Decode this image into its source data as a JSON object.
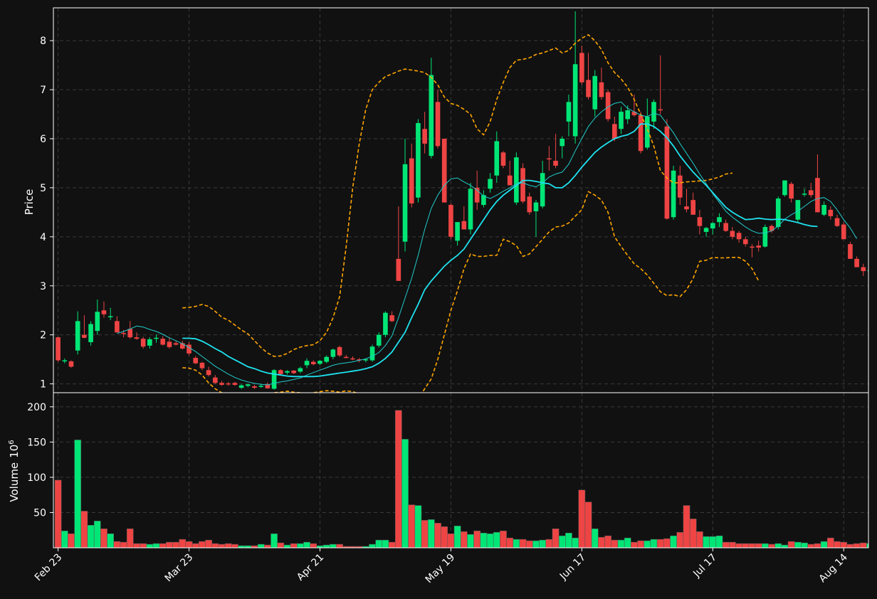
{
  "chart_data": [
    {
      "type": "candlestick",
      "ylabel": "Price",
      "ylim": [
        0.82,
        8.67
      ],
      "yticks": [
        "1",
        "2",
        "3",
        "4",
        "5",
        "6",
        "7",
        "8"
      ],
      "x_tick_labels": [
        "Feb 23",
        "Mar 23",
        "Apr 21",
        "May 19",
        "Jun 17",
        "Jul 17",
        "Aug 14"
      ],
      "x_tick_indices": [
        0,
        20,
        40,
        60,
        80,
        100,
        120
      ],
      "grid": true,
      "colors": {
        "up": "#00e676",
        "down": "#ef4444",
        "ma_fast": "#22cccc",
        "ma_slow": "#1ee3f0",
        "bands": "#ffa500"
      },
      "ohlc": [
        [
          1.95,
          1.96,
          1.45,
          1.48
        ],
        [
          1.46,
          1.52,
          1.42,
          1.48
        ],
        [
          1.46,
          1.48,
          1.33,
          1.35
        ],
        [
          1.68,
          2.48,
          1.6,
          2.28
        ],
        [
          2.0,
          2.4,
          1.93,
          1.94
        ],
        [
          1.85,
          2.28,
          1.78,
          2.22
        ],
        [
          2.08,
          2.72,
          2.0,
          2.47
        ],
        [
          2.5,
          2.68,
          2.35,
          2.42
        ],
        [
          2.38,
          2.55,
          2.3,
          2.38
        ],
        [
          2.28,
          2.38,
          2.05,
          2.05
        ],
        [
          2.04,
          2.1,
          1.95,
          2.02
        ],
        [
          2.12,
          2.28,
          1.92,
          1.95
        ],
        [
          1.95,
          2.05,
          1.9,
          1.92
        ],
        [
          1.92,
          1.96,
          1.72,
          1.76
        ],
        [
          1.78,
          1.95,
          1.72,
          1.91
        ],
        [
          1.93,
          2.01,
          1.84,
          1.94
        ],
        [
          1.92,
          1.97,
          1.78,
          1.8
        ],
        [
          1.86,
          1.95,
          1.72,
          1.75
        ],
        [
          1.83,
          1.87,
          1.78,
          1.8
        ],
        [
          1.83,
          1.88,
          1.7,
          1.72
        ],
        [
          1.8,
          1.85,
          1.58,
          1.62
        ],
        [
          1.53,
          1.57,
          1.4,
          1.42
        ],
        [
          1.43,
          1.45,
          1.28,
          1.32
        ],
        [
          1.28,
          1.35,
          1.15,
          1.18
        ],
        [
          1.13,
          1.18,
          1.0,
          1.02
        ],
        [
          1.02,
          1.06,
          0.96,
          0.98
        ],
        [
          1.01,
          1.04,
          0.96,
          0.99
        ],
        [
          1.02,
          1.04,
          0.96,
          0.98
        ],
        [
          0.92,
          0.99,
          0.9,
          0.97
        ],
        [
          0.96,
          1.0,
          0.93,
          0.99
        ],
        [
          0.95,
          0.98,
          0.9,
          0.92
        ],
        [
          0.95,
          1.0,
          0.92,
          0.96
        ],
        [
          0.99,
          1.03,
          0.9,
          0.91
        ],
        [
          0.9,
          1.3,
          0.88,
          1.28
        ],
        [
          1.28,
          1.3,
          1.18,
          1.2
        ],
        [
          1.23,
          1.28,
          1.19,
          1.26
        ],
        [
          1.27,
          1.28,
          1.2,
          1.22
        ],
        [
          1.25,
          1.35,
          1.22,
          1.32
        ],
        [
          1.38,
          1.52,
          1.32,
          1.47
        ],
        [
          1.45,
          1.48,
          1.38,
          1.4
        ],
        [
          1.41,
          1.49,
          1.38,
          1.47
        ],
        [
          1.45,
          1.58,
          1.42,
          1.55
        ],
        [
          1.55,
          1.72,
          1.5,
          1.7
        ],
        [
          1.75,
          1.78,
          1.55,
          1.58
        ],
        [
          1.55,
          1.59,
          1.52,
          1.54
        ],
        [
          1.52,
          1.56,
          1.48,
          1.5
        ],
        [
          1.5,
          1.53,
          1.44,
          1.48
        ],
        [
          1.48,
          1.52,
          1.44,
          1.5
        ],
        [
          1.48,
          1.8,
          1.45,
          1.76
        ],
        [
          1.78,
          2.05,
          1.74,
          2.0
        ],
        [
          2.0,
          2.48,
          1.95,
          2.45
        ],
        [
          2.4,
          2.48,
          2.26,
          2.28
        ],
        [
          3.55,
          4.62,
          3.45,
          3.1
        ],
        [
          3.9,
          6.0,
          3.7,
          5.48
        ],
        [
          5.6,
          5.9,
          4.6,
          4.68
        ],
        [
          4.8,
          6.4,
          4.7,
          6.32
        ],
        [
          6.2,
          6.55,
          5.7,
          5.9
        ],
        [
          5.65,
          7.65,
          5.6,
          7.3
        ],
        [
          6.75,
          7.0,
          5.8,
          5.85
        ],
        [
          6.0,
          6.0,
          4.8,
          4.7
        ],
        [
          4.65,
          4.68,
          3.95,
          4.0
        ],
        [
          3.92,
          4.3,
          3.82,
          4.3
        ],
        [
          4.32,
          4.62,
          4.15,
          4.15
        ],
        [
          4.15,
          5.1,
          4.05,
          4.98
        ],
        [
          5.0,
          5.35,
          4.55,
          4.7
        ],
        [
          4.65,
          4.95,
          4.6,
          4.85
        ],
        [
          4.98,
          5.3,
          4.9,
          5.18
        ],
        [
          5.25,
          6.15,
          5.1,
          5.95
        ],
        [
          5.72,
          5.75,
          5.4,
          5.45
        ],
        [
          5.25,
          5.55,
          5.05,
          5.05
        ],
        [
          4.7,
          5.72,
          4.65,
          5.62
        ],
        [
          5.4,
          5.5,
          4.68,
          4.72
        ],
        [
          4.82,
          4.9,
          4.45,
          4.5
        ],
        [
          4.52,
          4.75,
          4.0,
          4.7
        ],
        [
          4.62,
          5.55,
          4.58,
          5.3
        ],
        [
          5.6,
          5.85,
          5.35,
          5.58
        ],
        [
          5.55,
          6.1,
          5.4,
          5.45
        ],
        [
          5.85,
          6.05,
          5.6,
          6.0
        ],
        [
          6.35,
          6.9,
          6.05,
          6.75
        ],
        [
          6.05,
          8.6,
          5.9,
          7.52
        ],
        [
          7.75,
          7.9,
          7.1,
          7.15
        ],
        [
          7.2,
          7.75,
          6.8,
          6.85
        ],
        [
          6.6,
          7.4,
          6.45,
          7.28
        ],
        [
          7.15,
          7.45,
          6.8,
          6.85
        ],
        [
          6.95,
          7.0,
          6.35,
          6.4
        ],
        [
          6.3,
          6.45,
          5.95,
          6.0
        ],
        [
          6.2,
          6.65,
          6.1,
          6.55
        ],
        [
          6.4,
          6.68,
          6.3,
          6.58
        ],
        [
          6.55,
          6.9,
          6.45,
          6.48
        ],
        [
          6.48,
          6.55,
          5.7,
          5.75
        ],
        [
          5.82,
          6.82,
          5.78,
          6.45
        ],
        [
          6.35,
          6.8,
          6.2,
          6.75
        ],
        [
          6.6,
          7.7,
          6.5,
          6.58
        ],
        [
          6.25,
          6.4,
          4.35,
          4.37
        ],
        [
          4.4,
          5.45,
          4.35,
          5.35
        ],
        [
          5.25,
          5.45,
          4.65,
          4.8
        ],
        [
          4.62,
          4.98,
          4.5,
          4.56
        ],
        [
          4.75,
          4.9,
          4.45,
          4.45
        ],
        [
          4.4,
          4.55,
          4.05,
          4.22
        ],
        [
          4.1,
          4.2,
          4.0,
          4.18
        ],
        [
          4.17,
          4.3,
          4.05,
          4.28
        ],
        [
          4.3,
          4.48,
          4.2,
          4.4
        ],
        [
          4.28,
          4.35,
          4.1,
          4.12
        ],
        [
          4.12,
          4.2,
          3.95,
          4.0
        ],
        [
          4.08,
          4.12,
          3.88,
          3.95
        ],
        [
          3.95,
          4.0,
          3.8,
          3.85
        ],
        [
          3.8,
          3.85,
          3.58,
          3.78
        ],
        [
          3.82,
          3.92,
          3.7,
          3.78
        ],
        [
          3.8,
          4.25,
          3.78,
          4.2
        ],
        [
          4.22,
          4.25,
          4.08,
          4.12
        ],
        [
          4.2,
          4.82,
          4.15,
          4.78
        ],
        [
          4.85,
          5.15,
          4.82,
          5.15
        ],
        [
          5.08,
          5.12,
          4.7,
          4.78
        ],
        [
          4.35,
          4.75,
          4.3,
          4.75
        ],
        [
          4.88,
          4.98,
          4.82,
          4.88
        ],
        [
          4.95,
          5.1,
          4.8,
          4.85
        ],
        [
          5.2,
          5.68,
          4.5,
          4.5
        ],
        [
          4.45,
          4.72,
          4.42,
          4.65
        ],
        [
          4.55,
          4.62,
          4.35,
          4.42
        ],
        [
          4.38,
          4.45,
          4.2,
          4.22
        ],
        [
          4.25,
          4.3,
          3.98,
          3.95
        ],
        [
          3.85,
          3.9,
          3.55,
          3.55
        ],
        [
          3.55,
          3.6,
          3.38,
          3.38
        ],
        [
          3.38,
          3.45,
          3.2,
          3.3
        ],
        [
          3.3,
          3.42,
          3.25,
          3.32
        ]
      ],
      "ma_fast": [
        null,
        null,
        null,
        null,
        null,
        null,
        null,
        null,
        null,
        2.03,
        2.07,
        2.12,
        2.18,
        2.16,
        2.11,
        2.07,
        2.01,
        1.94,
        1.88,
        1.82,
        1.74,
        1.66,
        1.56,
        1.46,
        1.36,
        1.28,
        1.2,
        1.13,
        1.08,
        1.04,
        1.01,
        0.99,
        0.98,
        1.01,
        1.04,
        1.06,
        1.09,
        1.12,
        1.18,
        1.23,
        1.28,
        1.33,
        1.38,
        1.41,
        1.43,
        1.45,
        1.48,
        1.51,
        1.56,
        1.64,
        1.78,
        1.98,
        2.35,
        2.75,
        3.15,
        3.62,
        4.15,
        4.58,
        4.85,
        5.05,
        5.18,
        5.2,
        5.12,
        5.05,
        4.95,
        4.83,
        4.78,
        4.85,
        4.93,
        5.0,
        5.08,
        5.1,
        5.05,
        5.02,
        5.1,
        5.22,
        5.28,
        5.32,
        5.48,
        5.75,
        6.0,
        6.25,
        6.42,
        6.55,
        6.65,
        6.72,
        6.75,
        6.62,
        6.55,
        6.48,
        6.45,
        6.52,
        6.48,
        6.3,
        6.12,
        5.9,
        5.7,
        5.5,
        5.28,
        5.08,
        4.88,
        4.7,
        4.52,
        4.4,
        4.3,
        4.2,
        4.12,
        4.07,
        4.08,
        4.12,
        4.22,
        4.36,
        4.45,
        4.52,
        4.62,
        4.72,
        4.78,
        4.8,
        4.72,
        4.55,
        4.35,
        4.18,
        3.96,
        null
      ],
      "ma_slow": [
        null,
        null,
        null,
        null,
        null,
        null,
        null,
        null,
        null,
        null,
        null,
        null,
        null,
        null,
        null,
        null,
        null,
        null,
        null,
        1.93,
        1.93,
        1.92,
        1.87,
        1.8,
        1.72,
        1.65,
        1.56,
        1.49,
        1.42,
        1.35,
        1.31,
        1.26,
        1.22,
        1.2,
        1.18,
        1.16,
        1.15,
        1.15,
        1.15,
        1.15,
        1.16,
        1.18,
        1.2,
        1.22,
        1.24,
        1.26,
        1.28,
        1.31,
        1.35,
        1.42,
        1.52,
        1.65,
        1.85,
        2.05,
        2.35,
        2.62,
        2.92,
        3.1,
        3.25,
        3.4,
        3.52,
        3.62,
        3.75,
        3.95,
        4.15,
        4.35,
        4.55,
        4.72,
        4.85,
        4.95,
        5.05,
        5.15,
        5.15,
        5.13,
        5.1,
        5.08,
        5.0,
        5.0,
        5.1,
        5.25,
        5.42,
        5.57,
        5.72,
        5.83,
        5.92,
        6.0,
        6.05,
        6.08,
        6.15,
        6.3,
        6.3,
        6.25,
        6.15,
        6.02,
        5.85,
        5.65,
        5.48,
        5.32,
        5.18,
        5.05,
        4.9,
        4.75,
        4.6,
        4.5,
        4.42,
        4.35,
        4.36,
        4.38,
        4.36,
        4.35,
        4.36,
        4.35,
        4.32,
        4.29,
        4.25,
        4.22,
        4.21
      ],
      "upper_band": [
        null,
        null,
        null,
        null,
        null,
        null,
        null,
        null,
        null,
        null,
        null,
        null,
        null,
        null,
        null,
        null,
        null,
        null,
        null,
        2.55,
        2.56,
        2.58,
        2.62,
        2.58,
        2.48,
        2.36,
        2.3,
        2.2,
        2.1,
        2.02,
        1.88,
        1.74,
        1.63,
        1.56,
        1.57,
        1.62,
        1.7,
        1.75,
        1.78,
        1.8,
        1.88,
        2.05,
        2.35,
        2.78,
        3.8,
        5.0,
        5.9,
        6.6,
        7.0,
        7.15,
        7.27,
        7.32,
        7.38,
        7.42,
        7.4,
        7.38,
        7.35,
        7.25,
        7.1,
        6.85,
        6.72,
        6.68,
        6.6,
        6.5,
        6.2,
        6.08,
        6.35,
        6.8,
        7.15,
        7.45,
        7.6,
        7.62,
        7.65,
        7.72,
        7.75,
        7.8,
        7.85,
        7.75,
        7.8,
        7.95,
        8.05,
        8.12,
        8.0,
        7.82,
        7.55,
        7.35,
        7.22,
        7.05,
        6.8,
        6.5,
        6.2,
        5.85,
        5.35,
        5.2,
        5.1,
        5.1,
        5.12,
        5.13,
        5.14,
        5.15,
        5.18,
        5.22,
        5.28,
        5.3
      ],
      "lower_band": [
        null,
        null,
        null,
        null,
        null,
        null,
        null,
        null,
        null,
        null,
        null,
        null,
        null,
        null,
        null,
        null,
        null,
        null,
        null,
        1.33,
        1.32,
        1.28,
        1.18,
        1.02,
        0.9,
        0.82,
        0.78,
        0.72,
        0.7,
        0.7,
        0.72,
        0.76,
        0.8,
        0.82,
        0.83,
        0.85,
        0.83,
        0.82,
        0.8,
        0.82,
        0.84,
        0.86,
        0.85,
        0.83,
        0.86,
        0.84,
        0.8,
        0.7,
        0.6,
        0.55,
        0.5,
        0.45,
        0.4,
        0.45,
        0.5,
        0.7,
        0.9,
        1.1,
        1.5,
        2.0,
        2.5,
        2.9,
        3.35,
        3.65,
        3.6,
        3.6,
        3.62,
        3.62,
        3.95,
        3.9,
        3.82,
        3.6,
        3.65,
        3.8,
        3.95,
        4.1,
        4.2,
        4.22,
        4.28,
        4.42,
        4.55,
        4.92,
        4.85,
        4.75,
        4.5,
        4.0,
        3.8,
        3.62,
        3.45,
        3.35,
        3.22,
        3.05,
        2.88,
        2.8,
        2.82,
        2.78,
        2.92,
        3.15,
        3.5,
        3.52,
        3.58,
        3.57,
        3.57,
        3.58,
        3.58,
        3.5,
        3.35,
        3.1
      ]
    },
    {
      "type": "bar",
      "ylabel": "Volume",
      "ylabel_exponent": "10^6",
      "ylabel_base": "10",
      "ylabel_power": "6",
      "ylim": [
        0,
        220
      ],
      "yticks": [
        "50",
        "100",
        "150",
        "200"
      ],
      "values": [
        96,
        24,
        20,
        153,
        52,
        32,
        38,
        27,
        20,
        9,
        8,
        27,
        6,
        6,
        5,
        6,
        6,
        8,
        8,
        12,
        9,
        6,
        9,
        11,
        6,
        5,
        6,
        5,
        3,
        3,
        3,
        5,
        4,
        20,
        7,
        4,
        6,
        6,
        8,
        6,
        3,
        4,
        5,
        5,
        2,
        2,
        2,
        2,
        5,
        11,
        11,
        8,
        195,
        154,
        61,
        60,
        39,
        40,
        35,
        30,
        20,
        31,
        23,
        19,
        24,
        21,
        20,
        22,
        24,
        14,
        12,
        12,
        10,
        10,
        11,
        12,
        27,
        17,
        21,
        14,
        82,
        65,
        27,
        15,
        17,
        11,
        11,
        14,
        8,
        10,
        10,
        12,
        12,
        13,
        17,
        22,
        60,
        41,
        23,
        16,
        16,
        17,
        8,
        8,
        6,
        6,
        6,
        6,
        6,
        5,
        6,
        4,
        9,
        8,
        7,
        5,
        6,
        9,
        14,
        9,
        8,
        5,
        6,
        7,
        6,
        5,
        7
      ],
      "colors": {
        "up": "#00e676",
        "down": "#ef4444"
      }
    }
  ]
}
